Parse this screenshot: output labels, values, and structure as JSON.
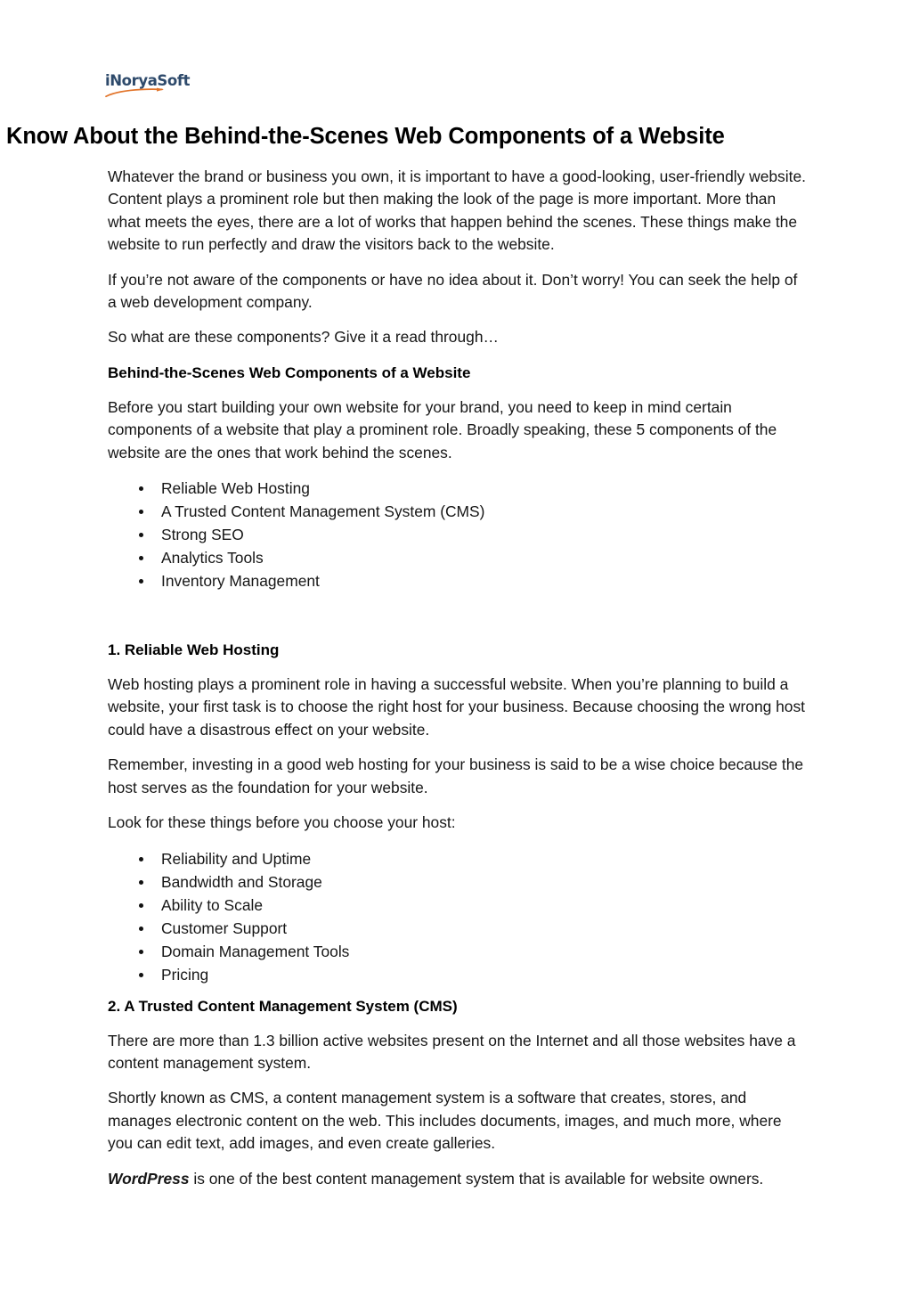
{
  "document": {
    "logo": {
      "name": "iNoryaSoft",
      "text_color": "#2e4a6b",
      "swoosh_color": "#e2742a"
    },
    "title": "Know About the Behind-the-Scenes Web Components of a Website",
    "blocks": [
      {
        "id": "intro-1",
        "type": "paragraph",
        "text": "Whatever the brand or business you own, it is important to have a good-looking, user-friendly website. Content plays a prominent role but then making the look of the page is more important. More than what meets the eyes, there are a lot of works that happen behind the scenes. These things make the website to run perfectly and draw the visitors back to the website."
      },
      {
        "id": "intro-2",
        "type": "paragraph",
        "text": "If you’re not aware of the components or have no idea about it. Don’t worry! You can seek the help of a web development company."
      },
      {
        "id": "intro-3",
        "type": "paragraph",
        "text": "So what are these components? Give it a read through…"
      },
      {
        "id": "subhead-components",
        "type": "subheading",
        "text": "Behind-the-Scenes Web Components of a Website"
      },
      {
        "id": "intro-4",
        "type": "paragraph",
        "text": "Before you start building your own website for your brand, you need to keep in mind certain components of a website that play a prominent role. Broadly speaking, these 5 components of the website are the ones that work behind the scenes."
      }
    ],
    "components_list": [
      "Reliable Web Hosting",
      "A Trusted Content Management System (CMS)",
      "Strong SEO",
      "Analytics Tools",
      "Inventory Management"
    ],
    "section_one": {
      "heading": "1. Reliable Web Hosting",
      "paragraphs": [
        "Web hosting plays a prominent role in having a successful website. When you’re planning to build a website, your first task is to choose the right host for your business. Because choosing the wrong host could have a disastrous effect on your website.",
        "Remember, investing in a good web hosting for your business is said to be a wise choice because the host serves as the foundation for your website.",
        "Look for these things before you choose your host:"
      ],
      "checklist": [
        "Reliability and Uptime",
        "Bandwidth and Storage",
        "Ability to Scale",
        "Customer Support",
        "Domain Management Tools",
        "Pricing"
      ]
    },
    "section_two": {
      "heading": "2. A Trusted Content Management System (CMS)",
      "paragraphs": [
        "There are more than 1.3 billion active websites present on the Internet and all those websites have a content management system.",
        "Shortly known as CMS, a content management system is a software that creates, stores, and manages electronic content on the web. This includes documents, images, and much more, where you can edit text, add images, and even create galleries."
      ],
      "closing": {
        "emphasis": "WordPress",
        "rest": " is one of the best content management system that is available for website owners."
      }
    }
  }
}
